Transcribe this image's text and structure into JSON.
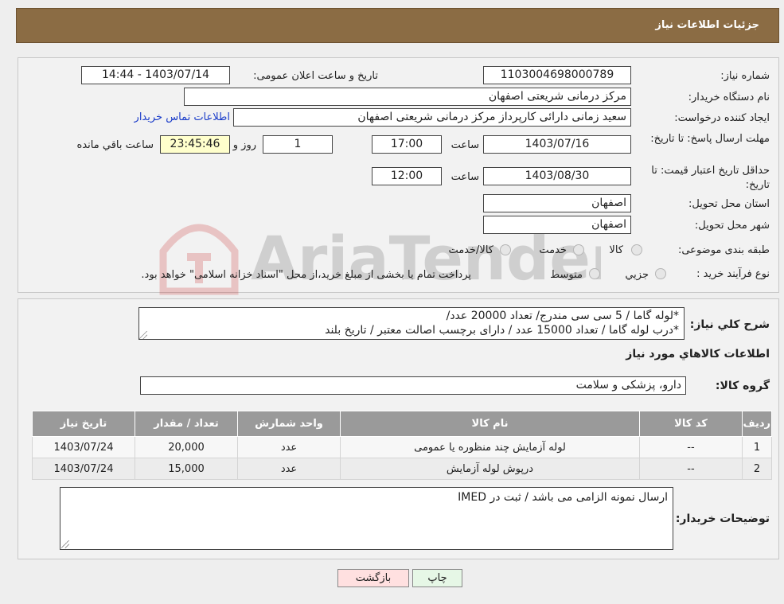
{
  "header": {
    "title": "جزئیات اطلاعات نیاز"
  },
  "form": {
    "need_number": {
      "label": "شماره نیاز:",
      "value": "1103004698000789"
    },
    "announce_date": {
      "label": "تاریخ و ساعت اعلان عمومی:",
      "value": "1403/07/14 - 14:44"
    },
    "buyer_org": {
      "label": "نام دستگاه خریدار:",
      "value": "مرکز درمانی شریعتی اصفهان"
    },
    "requester": {
      "label": "ایجاد کننده درخواست:",
      "value": "سعید زمانی دارائی کارپرداز مرکز درمانی شریعتی اصفهان",
      "contact_link": "اطلاعات تماس خریدار"
    },
    "deadline": {
      "label": "مهلت ارسال پاسخ: تا تاریخ:",
      "date": "1403/07/16",
      "time_label": "ساعت",
      "time": "17:00",
      "days": "1",
      "days_label": "روز و",
      "remaining": "23:45:46",
      "remaining_label": "ساعت باقي مانده"
    },
    "price_validity": {
      "label": "حداقل تاریخ اعتبار قیمت: تا تاریخ:",
      "date": "1403/08/30",
      "time_label": "ساعت",
      "time": "12:00"
    },
    "province": {
      "label": "استان محل تحویل:",
      "value": "اصفهان"
    },
    "city": {
      "label": "شهر محل تحویل:",
      "value": "اصفهان"
    },
    "category": {
      "label": "طبقه بندی موضوعی:",
      "options": [
        "کالا",
        "خدمت",
        "کالا/خدمت"
      ]
    },
    "purchase_type": {
      "label": "نوع فرآیند خرید :",
      "options": [
        "جزیي",
        "متوسط"
      ],
      "note": "پرداخت تمام یا بخشی از مبلغ خرید،از محل \"اسناد خزانه اسلامی\" خواهد بود."
    }
  },
  "details": {
    "description_label": "شرح کلي نياز:",
    "description_lines": [
      "*لوله گاما / 5 سی سی مندرج/ تعداد 20000 عدد/",
      "*درب لوله گاما / تعداد 15000 عدد / دارای برچسب اصالت معتبر / تاریخ بلند"
    ],
    "goods_heading": "اطلاعات کالاهاي مورد نياز",
    "goods_group_label": "گروه کالا:",
    "goods_group_value": "دارو، پزشکی و سلامت",
    "table": {
      "columns": [
        "رديف",
        "کد کالا",
        "نام کالا",
        "واحد شمارش",
        "تعداد / مقدار",
        "تاریخ نیاز"
      ],
      "rows": [
        [
          "1",
          "--",
          "لوله آزمایش چند منظوره یا عمومی",
          "عدد",
          "20,000",
          "1403/07/24"
        ],
        [
          "2",
          "--",
          "درپوش لوله آزمایش",
          "عدد",
          "15,000",
          "1403/07/24"
        ]
      ]
    },
    "buyer_notes_label": "توضیحات خریدار:",
    "buyer_notes": "ارسال نمونه الزامی می باشد / ثبت در IMED"
  },
  "buttons": {
    "print": "چاپ",
    "back": "بازگشت"
  },
  "watermark_text": "AriaTender.neT",
  "colors": {
    "header": "#8b6c44",
    "link": "#1a3cc9",
    "table_header": "#9a9a9a",
    "back_button": "#ffe0e0",
    "print_button": "#e6f7e6"
  }
}
